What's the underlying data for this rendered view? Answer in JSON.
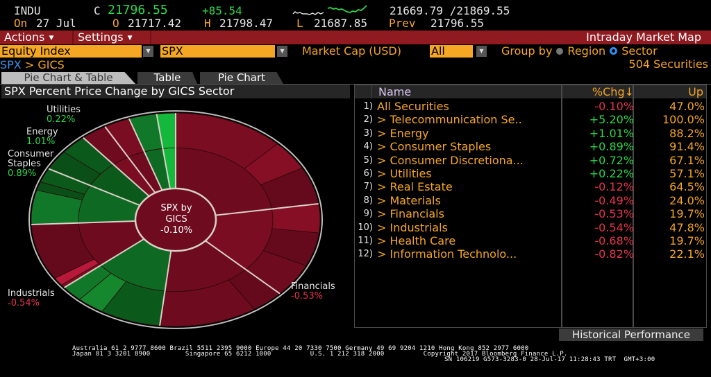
{
  "quote": {
    "ticker": "INDU",
    "close_label": "C",
    "close": "21796.55",
    "change": "+85.54",
    "range": "21669.79 /21869.55",
    "date_label": "On",
    "date": "27 Jul",
    "open_label": "O",
    "open": "21717.42",
    "high_label": "H",
    "high": "21798.47",
    "low_label": "L",
    "low": "21687.85",
    "prev_label": "Prev",
    "prev": "21796.55"
  },
  "toolbar": {
    "actions": "Actions",
    "settings": "Settings",
    "title": "Intraday Market Map"
  },
  "filters": {
    "asset_type": "Equity Index",
    "index": "SPX",
    "market_cap_label": "Market Cap (USD)",
    "market_cap": "All",
    "group_by_label": "Group by",
    "group_options": [
      "Region",
      "Sector"
    ],
    "group_selected": "Sector",
    "securities_count": "504 Securities"
  },
  "breadcrumb": {
    "root": "SPX",
    "sep": " > ",
    "leaf": "GICS"
  },
  "tabs": [
    {
      "label": "Pie Chart & Table",
      "active": true
    },
    {
      "label": "Table",
      "active": false
    },
    {
      "label": "Pie Chart",
      "active": false
    }
  ],
  "left_panel": {
    "title": "SPX Percent Price Change by GICS Sector"
  },
  "table": {
    "columns": [
      "Name",
      "%Chg",
      "Up"
    ],
    "sort_indicator": "↓",
    "rows": [
      {
        "num": "1)",
        "name": "All Securities",
        "chg": "-0.10%",
        "up": "47.0%",
        "prefix": ""
      },
      {
        "num": "2)",
        "name": "Telecommunication Se..",
        "chg": "+5.20%",
        "up": "100.0%",
        "prefix": "> "
      },
      {
        "num": "3)",
        "name": "Energy",
        "chg": "+1.01%",
        "up": "88.2%",
        "prefix": "> "
      },
      {
        "num": "4)",
        "name": "Consumer Staples",
        "chg": "+0.89%",
        "up": "91.4%",
        "prefix": "> "
      },
      {
        "num": "5)",
        "name": "Consumer Discretiona...",
        "chg": "+0.72%",
        "up": "67.1%",
        "prefix": "> "
      },
      {
        "num": "6)",
        "name": "Utilities",
        "chg": "+0.22%",
        "up": "57.1%",
        "prefix": "> "
      },
      {
        "num": "7)",
        "name": "Real Estate",
        "chg": "-0.12%",
        "up": "64.5%",
        "prefix": "> "
      },
      {
        "num": "8)",
        "name": "Materials",
        "chg": "-0.49%",
        "up": "24.0%",
        "prefix": "> "
      },
      {
        "num": "9)",
        "name": "Financials",
        "chg": "-0.53%",
        "up": "19.7%",
        "prefix": "> "
      },
      {
        "num": "10)",
        "name": "Industrials",
        "chg": "-0.54%",
        "up": "47.8%",
        "prefix": "> "
      },
      {
        "num": "11)",
        "name": "Health Care",
        "chg": "-0.68%",
        "up": "19.7%",
        "prefix": "> "
      },
      {
        "num": "12)",
        "name": "Information Technolo...",
        "chg": "-0.82%",
        "up": "22.1%",
        "prefix": "> "
      }
    ]
  },
  "historical_button": "Historical Performance",
  "chart_data": {
    "type": "pie",
    "title": "SPX Percent Price Change by GICS Sector",
    "center_label": [
      "SPX by",
      "GICS",
      "-0.10%"
    ],
    "labels": [
      {
        "name": "Utilities",
        "value": "0.22%"
      },
      {
        "name": "Energy",
        "value": "1.01%"
      },
      {
        "name": "Consumer Staples",
        "value": "0.89%"
      },
      {
        "name": "Industrials",
        "value": "-0.54%"
      },
      {
        "name": "Financials",
        "value": "-0.53%"
      }
    ],
    "sectors": [
      {
        "name": "Information Technology",
        "chg": -0.82,
        "weight": 22.5,
        "sub": [
          0.55,
          0.2,
          0.25
        ]
      },
      {
        "name": "Financials",
        "chg": -0.53,
        "weight": 14.5,
        "sub": [
          0.3,
          0.35,
          0.35
        ]
      },
      {
        "name": "Health Care",
        "chg": -0.68,
        "weight": 14.5,
        "sub": [
          0.25,
          0.75
        ]
      },
      {
        "name": "Consumer Discretionary",
        "chg": 0.72,
        "weight": 12.2,
        "sub": [
          0.55,
          0.25,
          0.2
        ]
      },
      {
        "name": "Industrials",
        "chg": -0.54,
        "weight": 10.2,
        "sub": [
          0.05,
          0.12,
          0.83
        ]
      },
      {
        "name": "Consumer Staples",
        "chg": 0.89,
        "weight": 8.6,
        "sub": [
          0.6,
          0.15,
          0.25
        ]
      },
      {
        "name": "Energy",
        "chg": 1.01,
        "weight": 6.0,
        "sub": [
          0.5,
          0.5
        ]
      },
      {
        "name": "Materials",
        "chg": -0.49,
        "weight": 2.9,
        "sub": [
          1.0
        ]
      },
      {
        "name": "Real Estate",
        "chg": -0.12,
        "weight": 2.9,
        "sub": [
          1.0
        ]
      },
      {
        "name": "Utilities",
        "chg": 0.22,
        "weight": 3.1,
        "sub": [
          1.0
        ]
      },
      {
        "name": "Telecommunication Services",
        "chg": 5.2,
        "weight": 2.1,
        "sub": [
          1.0
        ]
      }
    ]
  },
  "footer": {
    "line1": "Australia 61 2 9777 8600 Brazil 5511 2395 9000 Europe 44 20 7330 7500 Germany 49 69 9204 1210 Hong Kong 852 2977 6000",
    "line2": "Japan 81 3 3201 8900         Singapore 65 6212 1000          U.S. 1 212 318 2000          Copyright 2017 Bloomberg Finance L.P.",
    "line3": "SN 106219 G573-3283-0 28-Jul-17 11:28:43 TRT  GMT+3:00"
  }
}
